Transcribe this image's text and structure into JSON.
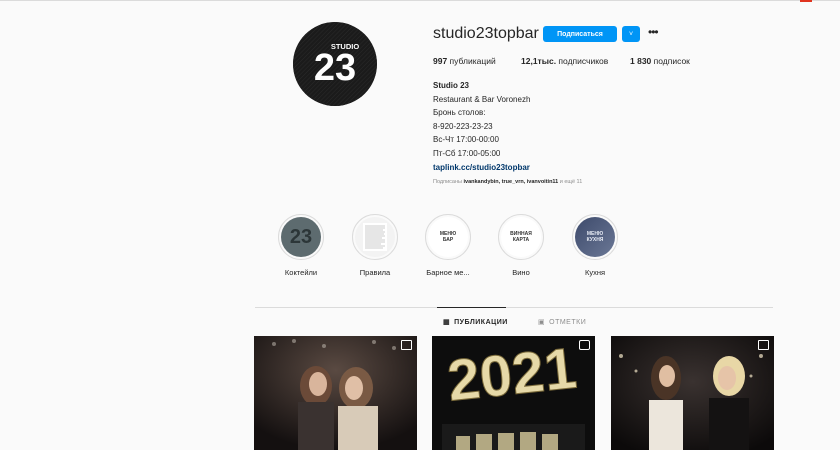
{
  "profile": {
    "username": "studio23topbar",
    "follow_label": "Подписаться",
    "dropdown_label": "˅",
    "more_label": "•••",
    "avatar_logo_word": "STUDIO",
    "avatar_logo_number": "23"
  },
  "stats": {
    "posts": "997",
    "posts_label": " публикаций",
    "followers": "12,1тыс.",
    "followers_label": " подписчиков",
    "following": "1 830",
    "following_label": " подписок"
  },
  "bio": {
    "name": "Studio 23",
    "lines": [
      "Restaurant & Bar Voronezh",
      "Бронь столов:",
      "8-920-223-23-23",
      "Вс-Чт 17:00-00:00",
      "Пт-Сб 17:00-05:00"
    ],
    "link": "taplink.cc/studio23topbar",
    "followed_by_prefix": "Подписаны ",
    "followed_by_names": "ivankandybin, true_vrn, ivanvoitin11",
    "followed_by_suffix": " и ещё 11"
  },
  "highlights": [
    {
      "label": "Коктейли",
      "cover_text": "23"
    },
    {
      "label": "Правила",
      "cover_text": ""
    },
    {
      "label": "Барное ме...",
      "cover_text": "МЕНЮ БАР"
    },
    {
      "label": "Вино",
      "cover_text": "ВИННАЯ КАРТА"
    },
    {
      "label": "Кухня",
      "cover_text": "МЕНЮ КУХНЯ"
    }
  ],
  "tabs": {
    "posts_label": "ПУБЛИКАЦИИ",
    "tagged_label": "ОТМЕТКИ"
  },
  "posts": [
    {
      "overlay_text": "",
      "badge": "multi-photo-icon"
    },
    {
      "overlay_text": "2021",
      "badge": "video-icon"
    },
    {
      "overlay_text": "",
      "badge": "multi-photo-icon"
    }
  ],
  "colors": {
    "accent": "#0095f6",
    "link": "#00376b",
    "muted": "#8e8e8e"
  }
}
